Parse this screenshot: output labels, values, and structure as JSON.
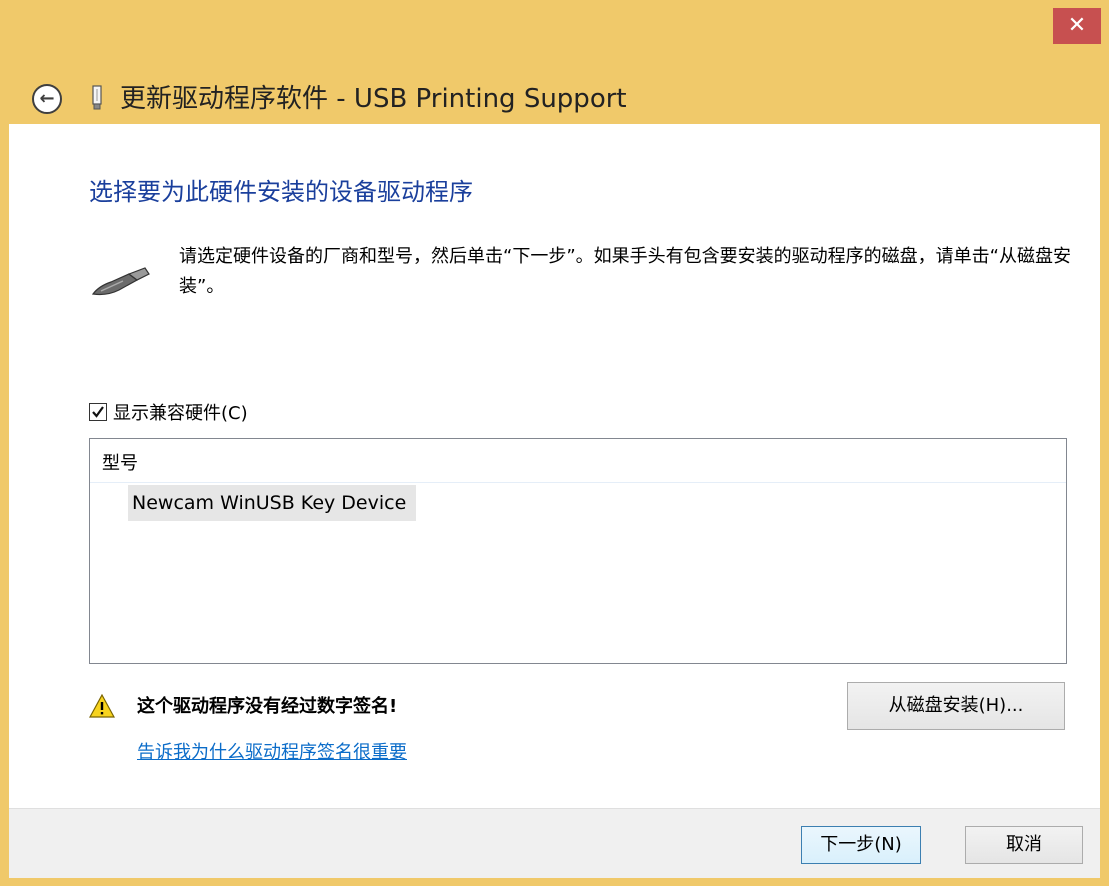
{
  "window": {
    "title": "更新驱动程序软件 - USB Printing Support",
    "close_glyph": "✕",
    "back_glyph": "←"
  },
  "content": {
    "heading": "选择要为此硬件安装的设备驱动程序",
    "instruction": "请选定硬件设备的厂商和型号，然后单击“下一步”。如果手头有包含要安装的驱动程序的磁盘，请单击“从磁盘安装”。",
    "show_compatible_label": "显示兼容硬件(C)",
    "show_compatible_checked": true,
    "list": {
      "column_header": "型号",
      "items": [
        "Newcam WinUSB Key Device"
      ]
    },
    "warning_text": "这个驱动程序没有经过数字签名!",
    "help_link": "告诉我为什么驱动程序签名很重要",
    "have_disk_button": "从磁盘安装(H)..."
  },
  "footer": {
    "next_button": "下一步(N)",
    "cancel_button": "取消"
  },
  "colors": {
    "frame": "#f0c96a",
    "close": "#c75050",
    "heading": "#1a3f9c",
    "link": "#0b6cc9"
  }
}
